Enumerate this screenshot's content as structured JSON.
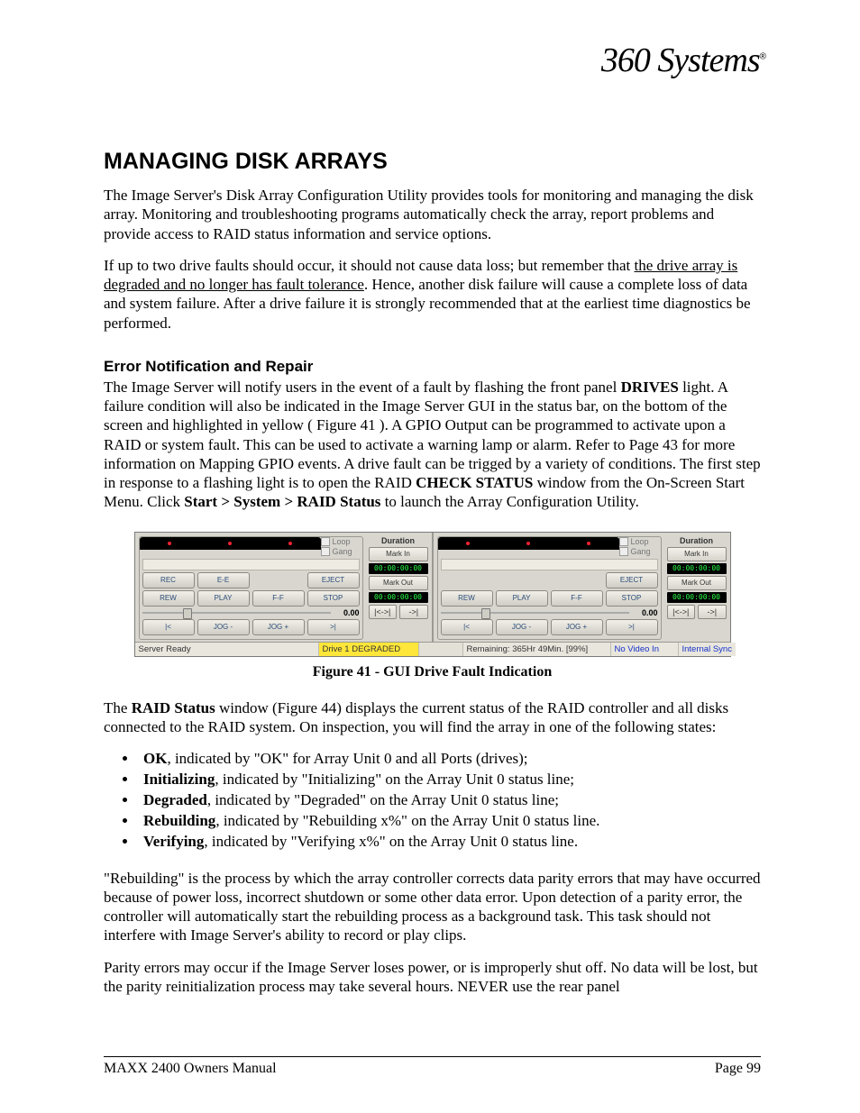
{
  "logo": "360 Systems",
  "heading": "MANAGING DISK ARRAYS",
  "p1": "The Image Server's Disk Array Configuration Utility provides tools for monitoring and managing the disk array.  Monitoring and troubleshooting programs automatically check the array, report problems and provide access to RAID status information and service options.",
  "p2a": "If up to two drive faults should occur, it should not cause data loss; but remember that ",
  "p2u": "the drive array is degraded and no longer has fault tolerance",
  "p2b": ".  Hence, another disk failure will cause a complete loss of data and system failure.  After a drive failure it is strongly recommended that at the earliest time diagnostics be performed.",
  "subhead1": "Error Notification and Repair",
  "p3a": "The Image Server will notify users in the event of a fault by flashing the front panel ",
  "p3b1": "DRIVES",
  "p3c": " light. A failure condition will also be indicated in the Image Server GUI in the status bar, on the bottom of the screen and highlighted in yellow ( Figure 41 ).  A GPIO Output can be programmed to activate upon a RAID or system fault. This can be used to activate a warning lamp or alarm. Refer to Page 43 for more information on Mapping GPIO events. A drive fault can be trigged by a variety of conditions.  The first step in response to a flashing light is to open the RAID ",
  "p3b2": "CHECK STATUS",
  "p3d": " window from the On-Screen Start Menu.  Click ",
  "p3b3": "Start  >  System  >  RAID Status",
  "p3e": " to launch the Array Configuration Utility.",
  "figcaption": "Figure 41 - GUI Drive Fault Indication",
  "p4a": "The ",
  "p4b1": "RAID Status",
  "p4b": " window (Figure 44) displays the current status of the RAID controller and all disks connected to the RAID system.  On inspection, you will find the array in one of the following states:",
  "list": [
    {
      "b": "OK",
      "t": ", indicated by \"OK\" for Array Unit 0 and all Ports (drives);"
    },
    {
      "b": "Initializing",
      "t": ", indicated by \"Initializing\" on the Array Unit 0 status line;"
    },
    {
      "b": "Degraded",
      "t": ", indicated by \"Degraded\" on the Array Unit 0 status line;"
    },
    {
      "b": "Rebuilding",
      "t": ", indicated by \"Rebuilding x%\" on the Array Unit 0 status line."
    },
    {
      "b": "Verifying",
      "t": ", indicated by \"Verifying x%\" on the Array Unit 0 status line."
    }
  ],
  "p5": "\"Rebuilding\" is the process by which the array controller corrects data parity errors that may have occurred because of power loss, incorrect shutdown or some other data error.  Upon detection of a parity error, the controller will automatically start the rebuilding process as a background task.  This task should not interfere with Image Server's ability to record or play clips.",
  "p6": "Parity errors may occur if the Image Server loses power, or is improperly shut off.  No data will be lost, but the parity reinitialization process may take several hours.  NEVER use the rear panel",
  "footer_left": "MAXX 2400 Owners Manual",
  "footer_right": "Page 99",
  "gui": {
    "checks": {
      "loop": "Loop",
      "gang": "Gang"
    },
    "side": {
      "duration": "Duration",
      "mark_in": "Mark In",
      "tc": "00:00:00:00",
      "mark_out": "Mark Out",
      "loop_open": "|<->|",
      "to_end": "->|"
    },
    "row1_left": [
      "REC",
      "E-E",
      "",
      "EJECT"
    ],
    "row1_right": [
      "",
      "",
      "",
      "EJECT"
    ],
    "row2": [
      "REW",
      "PLAY",
      "F-F",
      "STOP"
    ],
    "row3": [
      "|<",
      "JOG -",
      "JOG +",
      ">|"
    ],
    "slider_val": "0.00",
    "status": {
      "server_ready": "Server Ready",
      "degraded": "Drive 1 DEGRADED",
      "remaining": "Remaining: 365Hr 49Min. [99%]",
      "no_video": "No Video In",
      "sync": "Internal Sync"
    }
  }
}
